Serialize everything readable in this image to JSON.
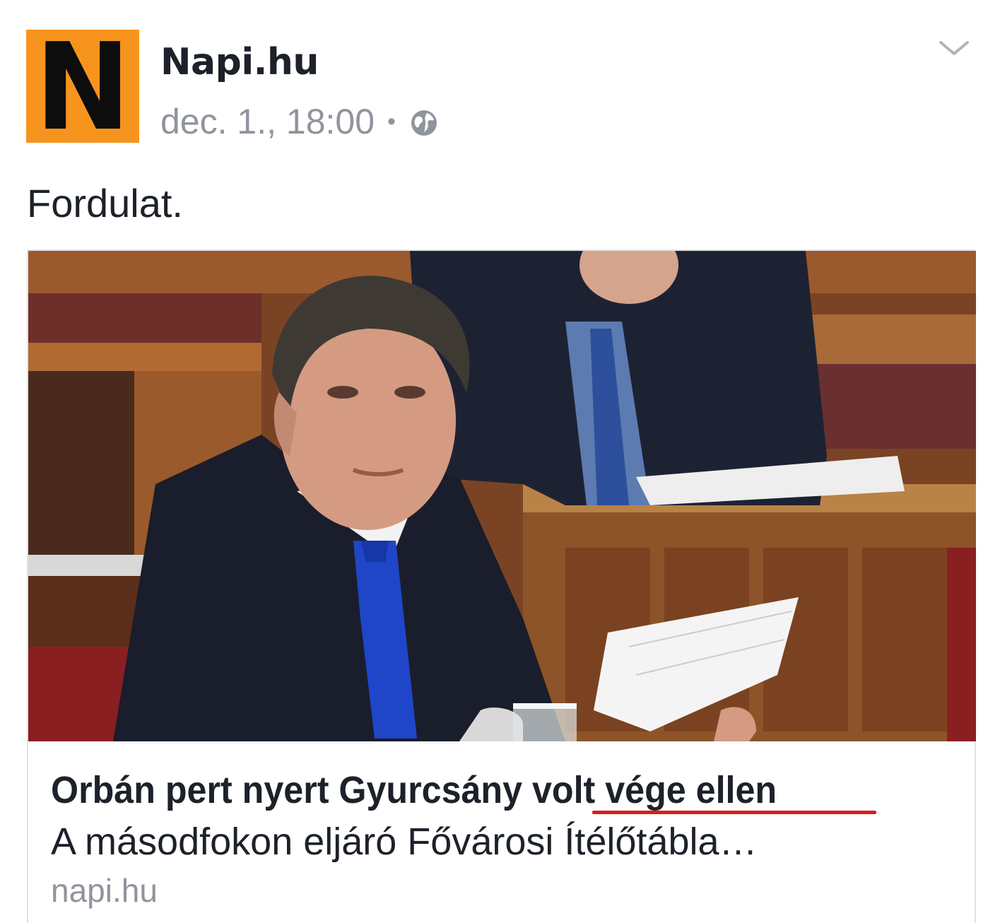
{
  "header": {
    "avatar_letter": "N",
    "avatar_color": "#f7941e",
    "page_name": "Napi.hu",
    "timestamp": "dec. 1., 18:00",
    "separator": "•",
    "privacy_icon": "globe-icon",
    "menu_icon": "chevron-down-icon"
  },
  "post": {
    "text": "Fordulat."
  },
  "link": {
    "image_description_icon": "photo",
    "title_main": "Orbán pert nyert Gyurcsány volt vége ellen",
    "underline_color": "#e31919",
    "description": "A másodfokon eljáró Fővárosi Ítélőtábla…",
    "domain": "napi.hu"
  }
}
